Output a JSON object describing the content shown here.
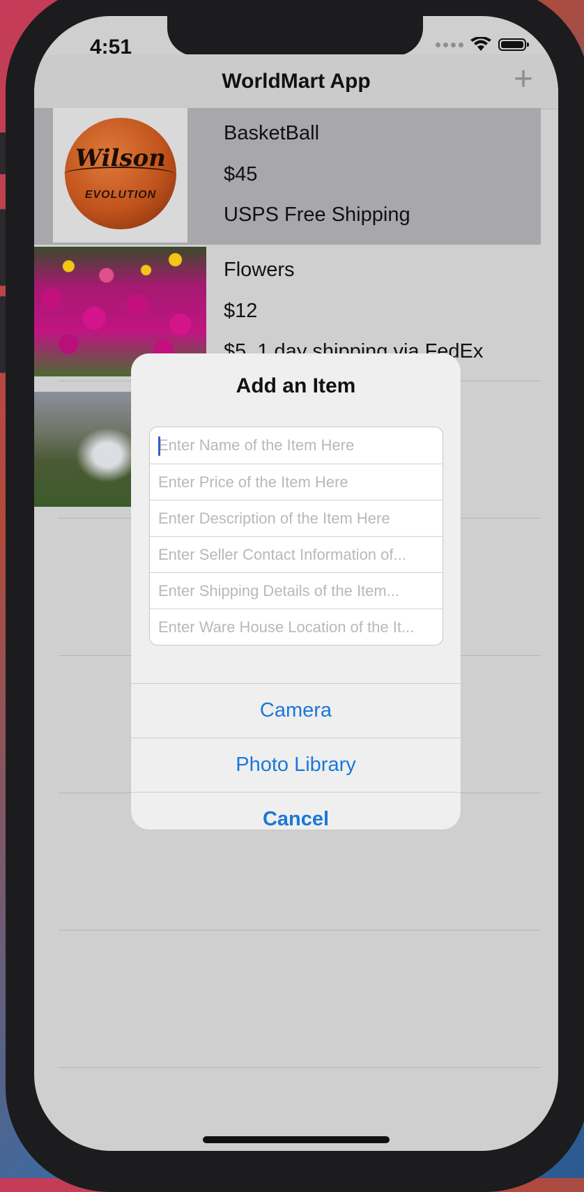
{
  "status_bar": {
    "time": "4:51"
  },
  "navbar": {
    "title": "WorldMart App",
    "add_icon": "plus-icon"
  },
  "items": [
    {
      "name": "BasketBall",
      "price": "$45",
      "shipping": "USPS Free Shipping",
      "image_text": "Wilson",
      "image_subtext": "EVOLUTION"
    },
    {
      "name": "Flowers",
      "price": "$12",
      "shipping": "$5, 1 day shipping via FedEx"
    },
    {
      "image": "waterfall"
    }
  ],
  "alert": {
    "title": "Add an Item",
    "fields": [
      {
        "placeholder": "Enter Name of the Item Here"
      },
      {
        "placeholder": "Enter Price of the Item Here"
      },
      {
        "placeholder": "Enter Description of the Item Here"
      },
      {
        "placeholder": "Enter Seller Contact Information of..."
      },
      {
        "placeholder": "Enter Shipping Details of the Item..."
      },
      {
        "placeholder": "Enter Ware House Location of the It..."
      }
    ],
    "actions": {
      "camera": "Camera",
      "photo_library": "Photo Library",
      "cancel": "Cancel"
    }
  },
  "colors": {
    "accent": "#1b78d8",
    "selected_row": "#a8a7ac",
    "background": "#cfcfcf"
  }
}
